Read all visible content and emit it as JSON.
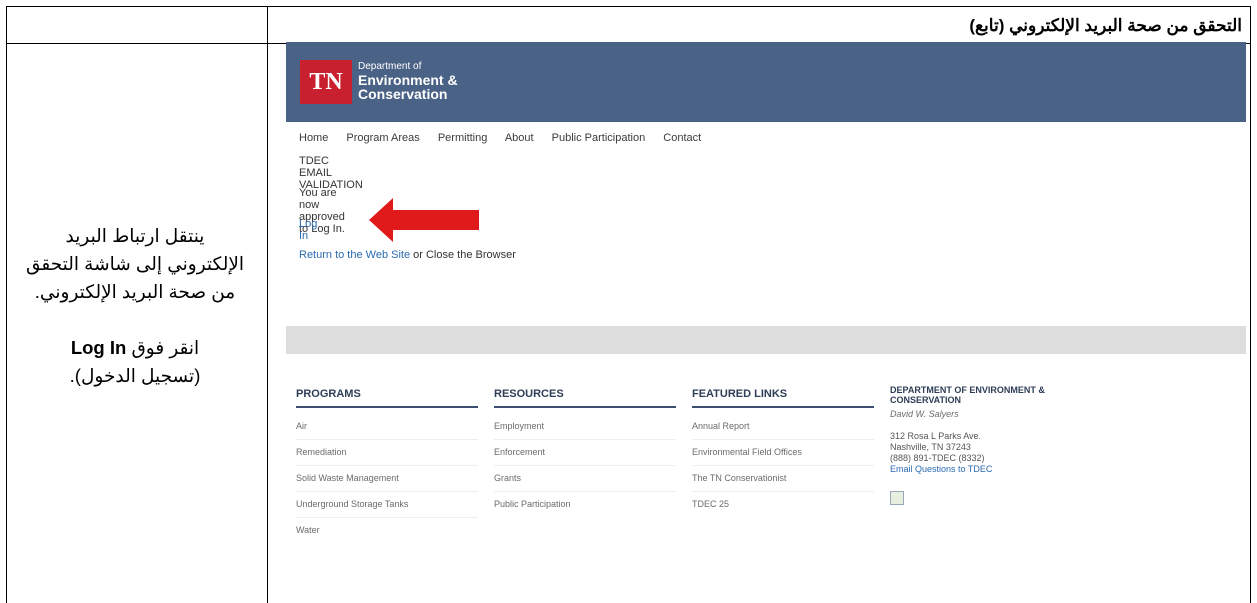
{
  "document": {
    "title": "التحقق من صحة البريد الإلكتروني (تابع)",
    "note": {
      "line1": "ينتقل ارتباط البريد",
      "line2": "الإلكتروني إلى شاشة التحقق",
      "line3": "من صحة البريد الإلكتروني.",
      "line4_prefix": "انقر فوق",
      "line4_bold": "Log In",
      "line5": "(تسجيل الدخول)."
    }
  },
  "site": {
    "logo": {
      "mark": "TN",
      "line1": "Department of",
      "line2": "Environment &",
      "line3": "Conservation"
    },
    "nav": [
      "Home",
      "Program Areas",
      "Permitting",
      "About",
      "Public Participation",
      "Contact"
    ],
    "page": {
      "heading": "TDEC EMAIL VALIDATION",
      "message": "You are now approved to Log In.",
      "login_link": "Log In",
      "return_link": "Return to the Web Site",
      "return_suffix": " or Close the Browser"
    },
    "footer": {
      "programs": {
        "title": "PROGRAMS",
        "items": [
          "Air",
          "Remediation",
          "Solid Waste Management",
          "Underground Storage Tanks",
          "Water"
        ]
      },
      "resources": {
        "title": "RESOURCES",
        "items": [
          "Employment",
          "Enforcement",
          "Grants",
          "Public Participation"
        ]
      },
      "featured": {
        "title": "FEATURED LINKS",
        "items": [
          "Annual Report",
          "Environmental Field Offices",
          "The TN Conservationist",
          "TDEC 25"
        ]
      },
      "dept": {
        "line1": "DEPARTMENT OF ENVIRONMENT &",
        "line2": "CONSERVATION",
        "commissioner": "David W. Salyers",
        "address1": "312 Rosa L Parks Ave.",
        "address2": "Nashville, TN 37243",
        "phone": "(888) 891-TDEC (8332)",
        "email_link": "Email Questions to TDEC"
      }
    }
  },
  "colors": {
    "header_bg": "#4a6285",
    "logo_red": "#c8202e",
    "arrow_red": "#e01a1a",
    "link_blue": "#2a6ab0"
  }
}
